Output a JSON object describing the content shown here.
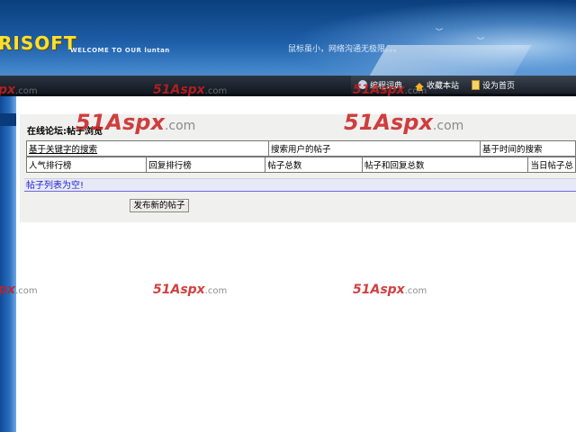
{
  "header": {
    "logo_text": "RISOFT",
    "welcome_text": "WELCOME TO OUR luntan",
    "slogan": "鼠标虽小，网络沟通无极限。。。",
    "links": [
      {
        "label": "编程词典",
        "icon": "dictionary-icon"
      },
      {
        "label": "收藏本站",
        "icon": "home-icon"
      },
      {
        "label": "设为首页",
        "icon": "page-icon"
      }
    ]
  },
  "forum": {
    "title": "在线论坛:帖子浏览",
    "search_row": [
      "基于关键字的搜索",
      "搜索用户的帖子",
      "基于时间的搜索"
    ],
    "rank_row": [
      "人气排行榜",
      "回复排行榜",
      "帖子总数",
      "帖子和回复总数",
      "当日帖子总"
    ],
    "empty_message": "帖子列表为空!",
    "new_post_button": "发布新的帖子"
  },
  "watermark": {
    "brand": "51Aspx",
    "suffix": ".com",
    "partial": "px",
    "color": "#c81e1e"
  },
  "colors": {
    "banner_dark": "#0a3f7d",
    "banner_light": "#6aa2d6",
    "empty_bar": "#e7e9f6",
    "empty_text": "#2222cc"
  }
}
